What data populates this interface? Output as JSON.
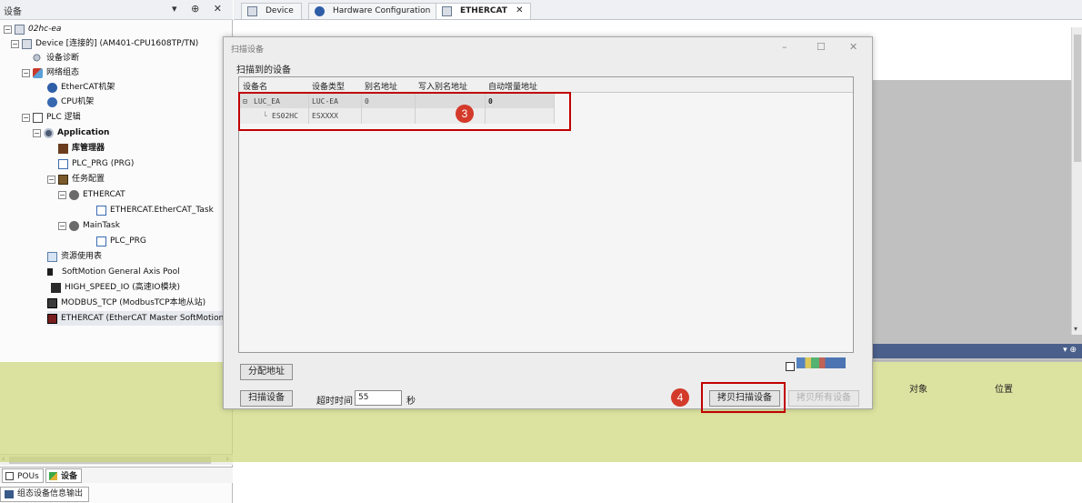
{
  "left_panel": {
    "title": "设备",
    "controls": "▾ ⊕ ✕",
    "tree": [
      {
        "label": "02hc-ea"
      },
      {
        "label": "Device [连接的] (AM401-CPU1608TP/TN)"
      },
      {
        "label": "设备诊断"
      },
      {
        "label": "网络组态"
      },
      {
        "label": "EtherCAT机架"
      },
      {
        "label": "CPU机架"
      },
      {
        "label": "PLC 逻辑"
      },
      {
        "label": "Application"
      },
      {
        "label": "库管理器"
      },
      {
        "label": "PLC_PRG (PRG)"
      },
      {
        "label": "任务配置"
      },
      {
        "label": "ETHERCAT"
      },
      {
        "label": "ETHERCAT.EtherCAT_Task"
      },
      {
        "label": "MainTask"
      },
      {
        "label": "PLC_PRG"
      },
      {
        "label": "资源使用表"
      },
      {
        "label": "SoftMotion General Axis Pool"
      },
      {
        "label": "HIGH_SPEED_IO (高速IO模块)"
      },
      {
        "label": "MODBUS_TCP (ModbusTCP本地从站)"
      },
      {
        "label": "ETHERCAT (EtherCAT Master SoftMotion)"
      }
    ],
    "tabs": {
      "pous": "POUs",
      "devices": "设备"
    },
    "bottom_tab": "组态设备信息输出"
  },
  "editor_tabs": [
    {
      "label": "Device"
    },
    {
      "label": "Hardware Configuration"
    },
    {
      "label": "ETHERCAT"
    }
  ],
  "dialog": {
    "title": "扫描设备",
    "section_label": "扫描到的设备",
    "columns": [
      "设备名",
      "设备类型",
      "别名地址",
      "写入别名地址",
      "自动增量地址"
    ],
    "rows": [
      {
        "name": "LUC_EA",
        "type": "LUC-EA",
        "alias": "0",
        "write_alias": "",
        "auto_inc": "0"
      },
      {
        "name": "ES02HC",
        "type": "ESXXXX",
        "alias": "",
        "write_alias": "",
        "auto_inc": ""
      }
    ],
    "assign_address_button": "分配地址",
    "scan_button": "扫描设备",
    "timeout_label": "超时时间",
    "timeout_value": "55",
    "timeout_unit": "秒",
    "copy_scanned_button": "拷贝扫描设备",
    "copy_all_button": "拷贝所有设备"
  },
  "right_panel": {
    "col_object": "对象",
    "col_position": "位置",
    "header_controls": "▾ ⊕"
  },
  "annotations": [
    {
      "number": "3"
    },
    {
      "number": "4"
    }
  ],
  "colors": {
    "annotation_red": "#c00000",
    "badge_red": "#d43a2a",
    "overlay_yellow": "#cdd778"
  }
}
